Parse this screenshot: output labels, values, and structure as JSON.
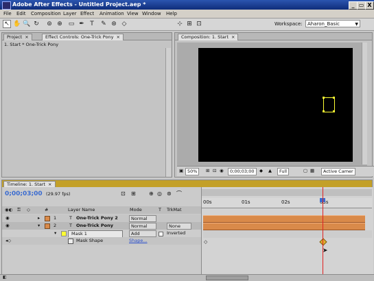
{
  "window": {
    "title": "Adobe After Effects - Untitled Project.aep *",
    "minimize_label": "_",
    "restore_label": "▭",
    "close_label": "X"
  },
  "menu": [
    "File",
    "Edit",
    "Composition",
    "Layer",
    "Effect",
    "Animation",
    "View",
    "Window",
    "Help"
  ],
  "toolbar": {
    "tools": [
      "selection-tool",
      "hand-tool",
      "zoom-tool",
      "rotation-tool",
      "camera-orbit-tool",
      "pan-behind-tool",
      "rectangle-mask-tool",
      "pen-tool",
      "text-tool",
      "brush-tool",
      "clone-stamp-tool",
      "eraser-tool"
    ],
    "tool_glyphs": [
      "↖",
      "✋",
      "🔍",
      "↻",
      "⊚",
      "⊕",
      "▭",
      "✒",
      "T",
      "✎",
      "⊛",
      "◇"
    ],
    "workspace_label": "Workspace:",
    "workspace_value": "Aharon_Basic"
  },
  "left_panel": {
    "tabs": [
      "Project",
      "Effect Controls: One-Trick Pony"
    ],
    "header": "1. Start * One-Trick Pony"
  },
  "comp_panel": {
    "tab": "Composition: 1. Start",
    "zoom": "50%",
    "timecode": "0;00;03;00",
    "resolution": "Full",
    "active_camera": "Active Camer"
  },
  "timeline": {
    "tab": "Timeline: 1. Start",
    "timecode": "0;00;03;00",
    "fps": "(29.97 fps)",
    "columns": {
      "layer_name": "Layer Name",
      "mode": "Mode",
      "t": "T",
      "trkmat": "TrkMat",
      "num": "#"
    },
    "ruler_labels": [
      "00s",
      "01s",
      "02s",
      "03s"
    ],
    "layers": [
      {
        "num": "1",
        "name": "One-Trick Pony 2",
        "mode": "Normal",
        "trkmat": "",
        "color": "#d98a4a"
      },
      {
        "num": "2",
        "name": "One-Trick Pony",
        "mode": "Normal",
        "trkmat": "None",
        "color": "#d98a4a"
      }
    ],
    "mask": {
      "name": "Mask 1",
      "mode": "Add",
      "inverted_label": "Inverted",
      "color": "#ffff33"
    },
    "mask_shape": {
      "label": "Mask Shape",
      "value": "Shape..."
    }
  },
  "colors": {
    "title_bar": "#1f3f95",
    "panel_bg": "#c4c4c4",
    "layer_bar": "#d98a4a",
    "current_time_indicator": "#e02020",
    "timecode_text": "#3a6bd0",
    "mask_color": "#ffff33"
  }
}
